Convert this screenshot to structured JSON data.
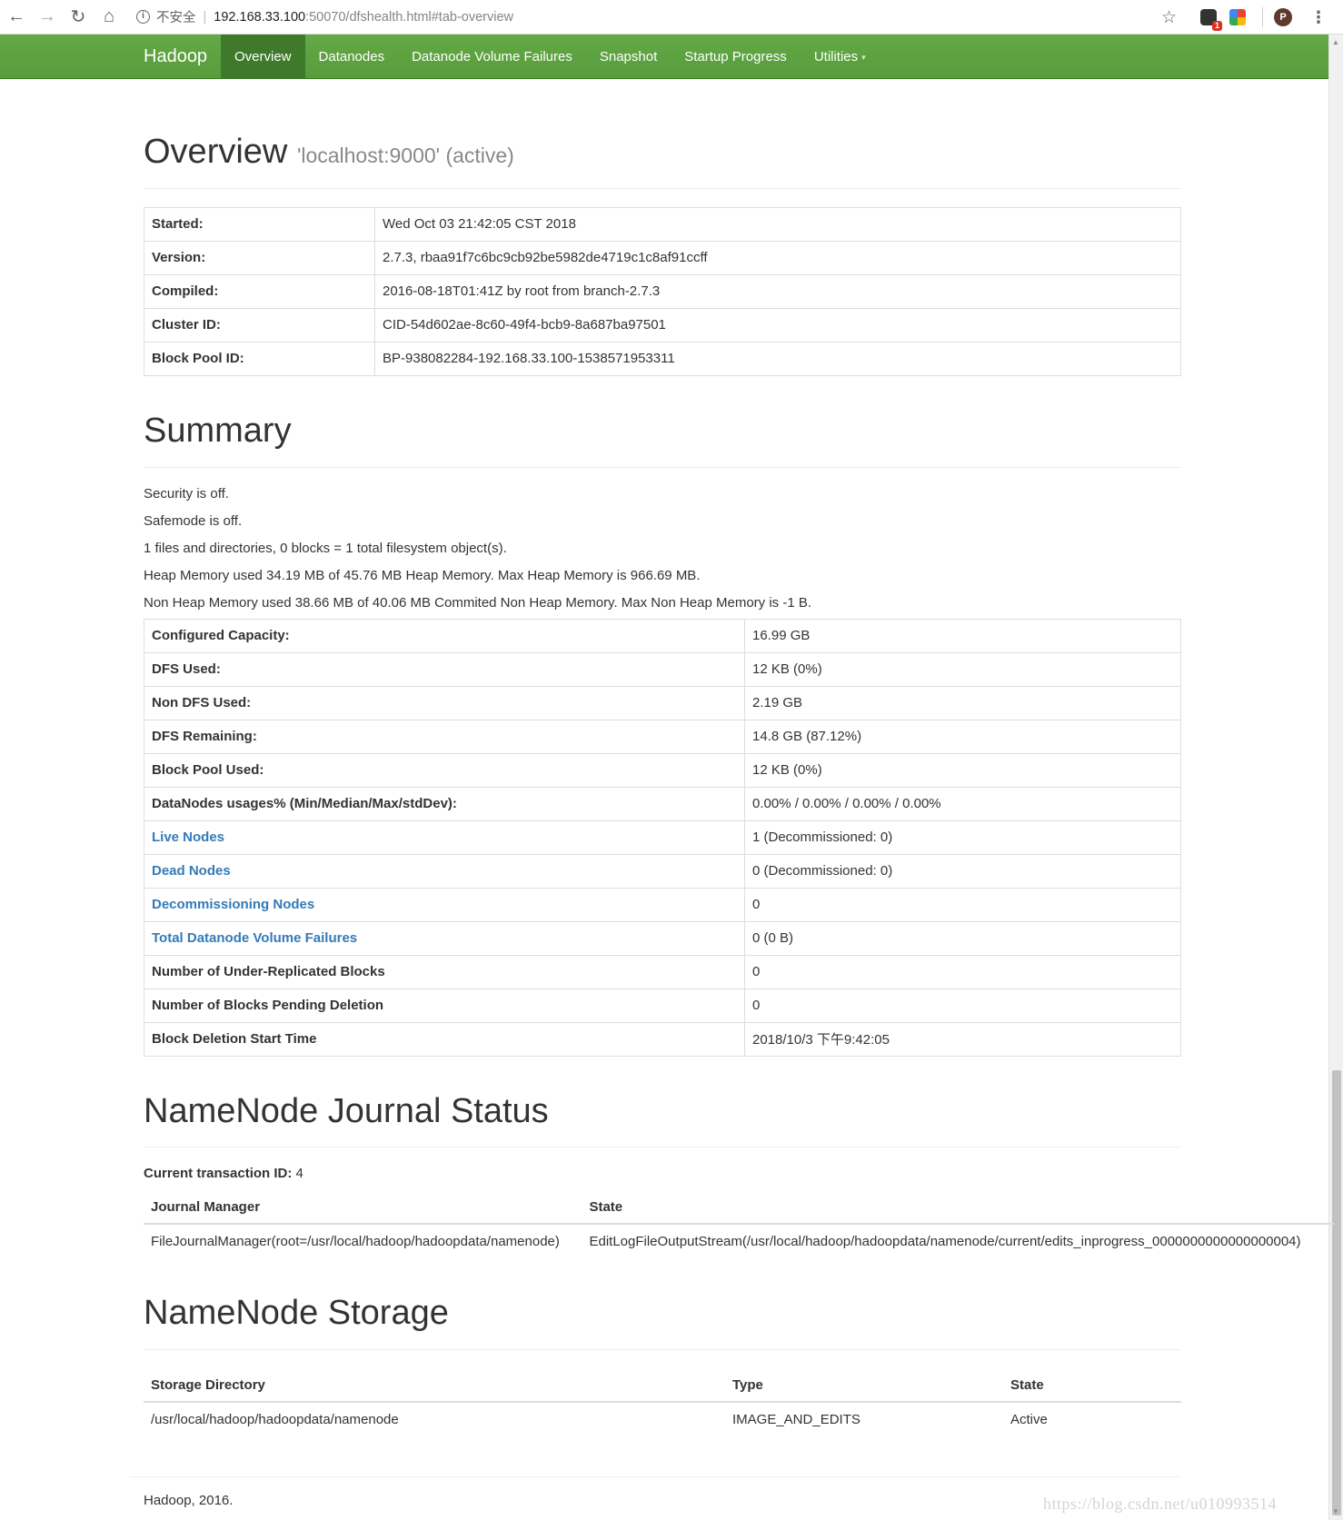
{
  "browser": {
    "insecure_label": "不安全",
    "url_host": "192.168.33.100",
    "url_rest": ":50070/dfshealth.html#tab-overview",
    "ext_badge": "1",
    "profile_initial": "P"
  },
  "navbar": {
    "brand": "Hadoop",
    "items": [
      {
        "label": "Overview",
        "active": true
      },
      {
        "label": "Datanodes"
      },
      {
        "label": "Datanode Volume Failures"
      },
      {
        "label": "Snapshot"
      },
      {
        "label": "Startup Progress"
      },
      {
        "label": "Utilities"
      }
    ],
    "bg_color": "#5aa03e",
    "active_color": "#3f7a2a"
  },
  "overview": {
    "title": "Overview",
    "subtitle": "'localhost:9000' (active)",
    "rows": [
      {
        "key": "Started:",
        "value": "Wed Oct 03 21:42:05 CST 2018"
      },
      {
        "key": "Version:",
        "value": "2.7.3, rbaa91f7c6bc9cb92be5982de4719c1c8af91ccff"
      },
      {
        "key": "Compiled:",
        "value": "2016-08-18T01:41Z by root from branch-2.7.3"
      },
      {
        "key": "Cluster ID:",
        "value": "CID-54d602ae-8c60-49f4-bcb9-8a687ba97501"
      },
      {
        "key": "Block Pool ID:",
        "value": "BP-938082284-192.168.33.100-1538571953311"
      }
    ]
  },
  "summary": {
    "title": "Summary",
    "lines": [
      "Security is off.",
      "Safemode is off.",
      "1 files and directories, 0 blocks = 1 total filesystem object(s).",
      "Heap Memory used 34.19 MB of 45.76 MB Heap Memory. Max Heap Memory is 966.69 MB.",
      "Non Heap Memory used 38.66 MB of 40.06 MB Commited Non Heap Memory. Max Non Heap Memory is -1 B."
    ],
    "rows": [
      {
        "key": "Configured Capacity:",
        "value": "16.99 GB"
      },
      {
        "key": "DFS Used:",
        "value": "12 KB (0%)"
      },
      {
        "key": "Non DFS Used:",
        "value": "2.19 GB"
      },
      {
        "key": "DFS Remaining:",
        "value": "14.8 GB (87.12%)"
      },
      {
        "key": "Block Pool Used:",
        "value": "12 KB (0%)"
      },
      {
        "key": "DataNodes usages% (Min/Median/Max/stdDev):",
        "value": "0.00% / 0.00% / 0.00% / 0.00%"
      },
      {
        "key": "Live Nodes",
        "value": "1 (Decommissioned: 0)",
        "link": true
      },
      {
        "key": "Dead Nodes",
        "value": "0 (Decommissioned: 0)",
        "link": true
      },
      {
        "key": "Decommissioning Nodes",
        "value": "0",
        "link": true
      },
      {
        "key": "Total Datanode Volume Failures",
        "value": "0 (0 B)",
        "link": true
      },
      {
        "key": "Number of Under-Replicated Blocks",
        "value": "0"
      },
      {
        "key": "Number of Blocks Pending Deletion",
        "value": "0"
      },
      {
        "key": "Block Deletion Start Time",
        "value": "2018/10/3 下午9:42:05"
      }
    ]
  },
  "journal": {
    "title": "NameNode Journal Status",
    "txid_label": "Current transaction ID:",
    "txid_value": "4",
    "headers": [
      "Journal Manager",
      "State"
    ],
    "rows": [
      [
        "FileJournalManager(root=/usr/local/hadoop/hadoopdata/namenode)",
        "EditLogFileOutputStream(/usr/local/hadoop/hadoopdata/namenode/current/edits_inprogress_0000000000000000004)"
      ]
    ]
  },
  "storage": {
    "title": "NameNode Storage",
    "headers": [
      "Storage Directory",
      "Type",
      "State"
    ],
    "rows": [
      [
        "/usr/local/hadoop/hadoopdata/namenode",
        "IMAGE_AND_EDITS",
        "Active"
      ]
    ]
  },
  "footer": {
    "text": "Hadoop, 2016.",
    "watermark": "https://blog.csdn.net/u010993514"
  },
  "colors": {
    "link": "#337ab7",
    "text": "#333333",
    "muted": "#888888"
  }
}
